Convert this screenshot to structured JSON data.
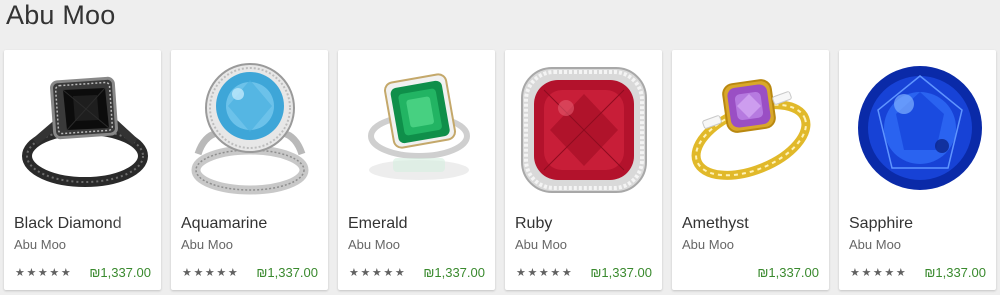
{
  "section": {
    "title": "Abu Moo"
  },
  "colors": {
    "price": "#3a8a2e",
    "background": "#eeeeee"
  },
  "cards": [
    {
      "name": "Black Diamond",
      "developer": "Abu Moo",
      "rating_stars": "★★★★★",
      "price": "₪1,337.00",
      "image": "black-diamond-ring"
    },
    {
      "name": "Aquamarine",
      "developer": "Abu Moo",
      "rating_stars": "★★★★★",
      "price": "₪1,337.00",
      "image": "aquamarine-ring"
    },
    {
      "name": "Emerald",
      "developer": "Abu Moo",
      "rating_stars": "★★★★★",
      "price": "₪1,337.00",
      "image": "emerald-ring"
    },
    {
      "name": "Ruby",
      "developer": "Abu Moo",
      "rating_stars": "★★★★★",
      "price": "₪1,337.00",
      "image": "ruby-gem"
    },
    {
      "name": "Amethyst",
      "developer": "Abu Moo",
      "rating_stars": "",
      "price": "₪1,337.00",
      "image": "amethyst-ring"
    },
    {
      "name": "Sapphire",
      "developer": "Abu Moo",
      "rating_stars": "★★★★★",
      "price": "₪1,337.00",
      "image": "sapphire-gem"
    }
  ]
}
